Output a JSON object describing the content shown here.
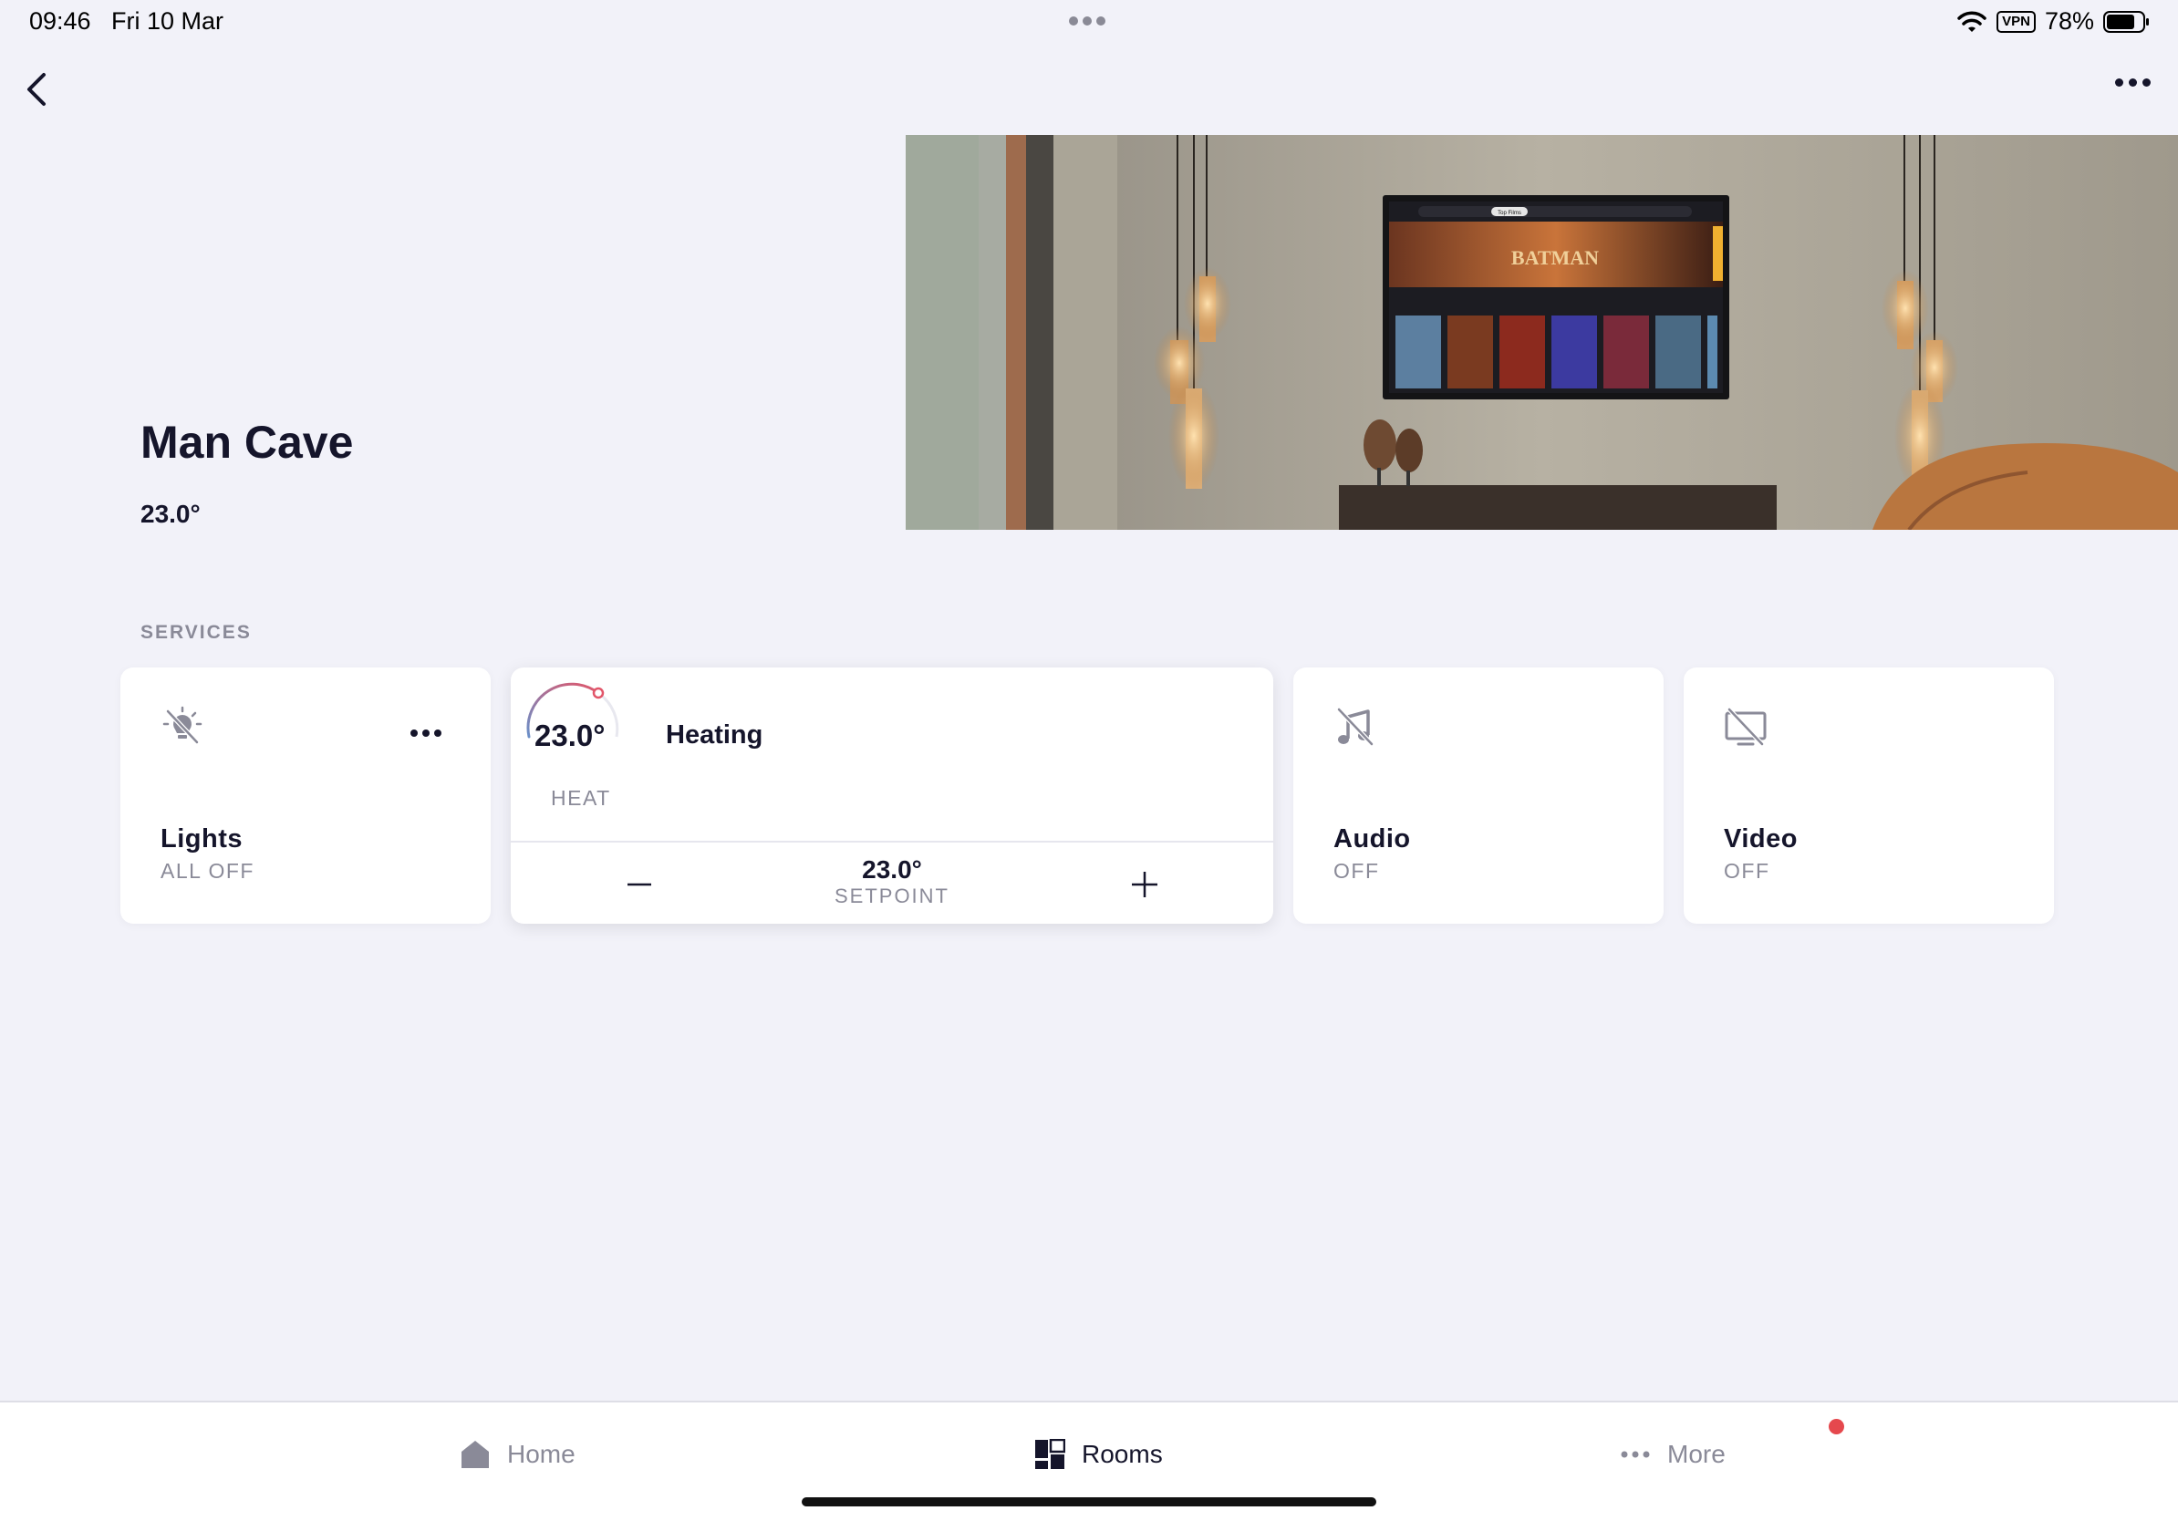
{
  "status_bar": {
    "time": "09:46",
    "date": "Fri 10 Mar",
    "vpn": "VPN",
    "battery": "78%"
  },
  "room": {
    "name": "Man Cave",
    "temperature": "23.0°"
  },
  "services": {
    "section_label": "SERVICES",
    "lights": {
      "title": "Lights",
      "status": "ALL OFF",
      "icon": "light-bulb-off-icon"
    },
    "heating": {
      "current_temp": "23.0°",
      "title": "Heating",
      "mode": "HEAT",
      "setpoint_value": "23.0°",
      "setpoint_label": "SETPOINT"
    },
    "audio": {
      "title": "Audio",
      "status": "OFF",
      "icon": "music-off-icon"
    },
    "video": {
      "title": "Video",
      "status": "OFF",
      "icon": "tv-off-icon"
    }
  },
  "tab_bar": {
    "home": "Home",
    "rooms": "Rooms",
    "more": "More",
    "active": "rooms"
  },
  "hero_tv": {
    "tabs": [
      "Top Films"
    ],
    "featured": "BATMAN"
  },
  "colors": {
    "background": "#f2f2f9",
    "text": "#15152b",
    "muted": "#8a8a98",
    "notification": "#e5484d"
  }
}
